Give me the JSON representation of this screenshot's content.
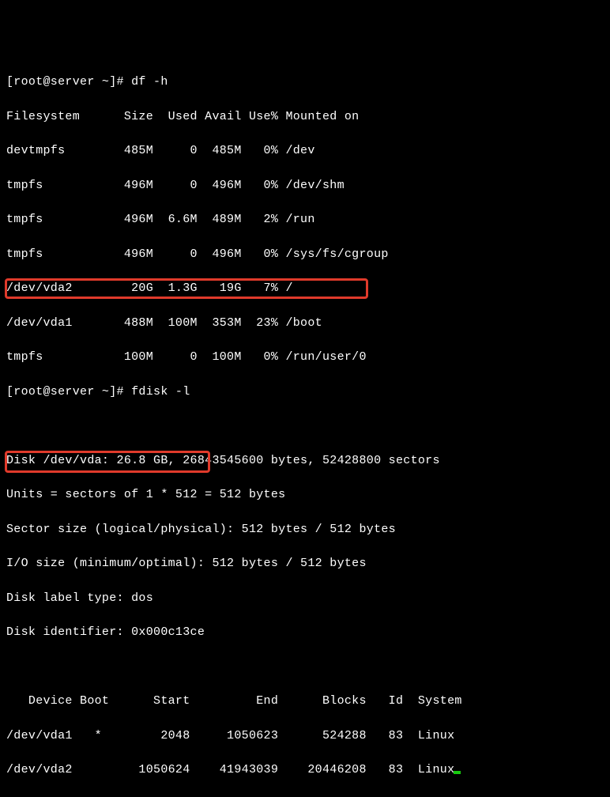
{
  "prompt1": "[root@server ~]# df -h",
  "df_header": "Filesystem      Size  Used Avail Use% Mounted on",
  "df_rows": [
    "devtmpfs        485M     0  485M   0% /dev",
    "tmpfs           496M     0  496M   0% /dev/shm",
    "tmpfs           496M  6.6M  489M   2% /run",
    "tmpfs           496M     0  496M   0% /sys/fs/cgroup",
    "/dev/vda2        20G  1.3G   19G   7% /",
    "/dev/vda1       488M  100M  353M  23% /boot",
    "tmpfs           100M     0  100M   0% /run/user/0"
  ],
  "prompt2": "[root@server ~]# fdisk -l",
  "blank": " ",
  "fdisk": {
    "diskline": "Disk /dev/vda: 26.8 GB, 26843545600 bytes, 52428800 sectors",
    "units": "Units = sectors of 1 * 512 = 512 bytes",
    "sector": "Sector size (logical/physical): 512 bytes / 512 bytes",
    "io": "I/O size (minimum/optimal): 512 bytes / 512 bytes",
    "labeltype": "Disk label type: dos",
    "identifier": "Disk identifier: 0x000c13ce"
  },
  "part_header": "   Device Boot      Start         End      Blocks   Id  System",
  "part_rows": [
    "/dev/vda1   *        2048     1050623      524288   83  Linux",
    "/dev/vda2         1050624    41943039    20446208   83  Linux"
  ],
  "chart_data": {
    "type": "table",
    "df": {
      "columns": [
        "Filesystem",
        "Size",
        "Used",
        "Avail",
        "Use%",
        "Mounted on"
      ],
      "rows": [
        [
          "devtmpfs",
          "485M",
          "0",
          "485M",
          "0%",
          "/dev"
        ],
        [
          "tmpfs",
          "496M",
          "0",
          "496M",
          "0%",
          "/dev/shm"
        ],
        [
          "tmpfs",
          "496M",
          "6.6M",
          "489M",
          "2%",
          "/run"
        ],
        [
          "tmpfs",
          "496M",
          "0",
          "496M",
          "0%",
          "/sys/fs/cgroup"
        ],
        [
          "/dev/vda2",
          "20G",
          "1.3G",
          "19G",
          "7%",
          "/"
        ],
        [
          "/dev/vda1",
          "488M",
          "100M",
          "353M",
          "23%",
          "/boot"
        ],
        [
          "tmpfs",
          "100M",
          "0",
          "100M",
          "0%",
          "/run/user/0"
        ]
      ]
    },
    "partitions": {
      "columns": [
        "Device",
        "Boot",
        "Start",
        "End",
        "Blocks",
        "Id",
        "System"
      ],
      "rows": [
        [
          "/dev/vda1",
          "*",
          2048,
          1050623,
          524288,
          83,
          "Linux"
        ],
        [
          "/dev/vda2",
          "",
          1050624,
          41943039,
          20446208,
          83,
          "Linux"
        ]
      ]
    }
  }
}
